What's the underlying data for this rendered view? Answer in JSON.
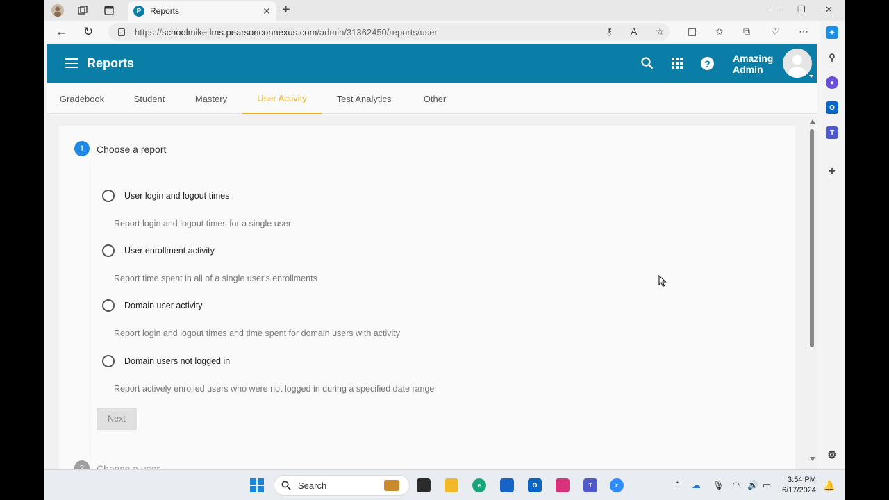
{
  "browser": {
    "tab_title": "Reports",
    "tab_favicon_letter": "P",
    "url_prefix": "https://",
    "url_host": "schoolmike.lms.pearsonconnexus.com",
    "url_path": "/admin/31362450/reports/user"
  },
  "header": {
    "title": "Reports",
    "user_line1": "Amazing",
    "user_line2": "Admin",
    "help_glyph": "?"
  },
  "tabs": [
    {
      "label": "Gradebook"
    },
    {
      "label": "Student"
    },
    {
      "label": "Mastery"
    },
    {
      "label": "User Activity",
      "active": true
    },
    {
      "label": "Test Analytics"
    },
    {
      "label": "Other"
    }
  ],
  "steps": [
    {
      "number": "1",
      "label": "Choose a report",
      "color": "#1e88e5"
    },
    {
      "number": "2",
      "label": "Choose a user",
      "color": "#9e9e9e"
    }
  ],
  "options": [
    {
      "label": "User login and logout times",
      "description": "Report login and logout times for a single user"
    },
    {
      "label": "User enrollment activity",
      "description": "Report time spent in all of a single user's enrollments"
    },
    {
      "label": "Domain user activity",
      "description": "Report login and logout times and time spent for domain users with activity"
    },
    {
      "label": "Domain users not logged in",
      "description": "Report actively enrolled users who were not logged in during a specified date range"
    }
  ],
  "next_button": "Next",
  "taskbar": {
    "search_label": "Search",
    "time": "3:54 PM",
    "date": "6/17/2024"
  },
  "colors": {
    "header": "#0b7ea8",
    "active_tab": "#e8b020",
    "step_active": "#1e88e5"
  }
}
